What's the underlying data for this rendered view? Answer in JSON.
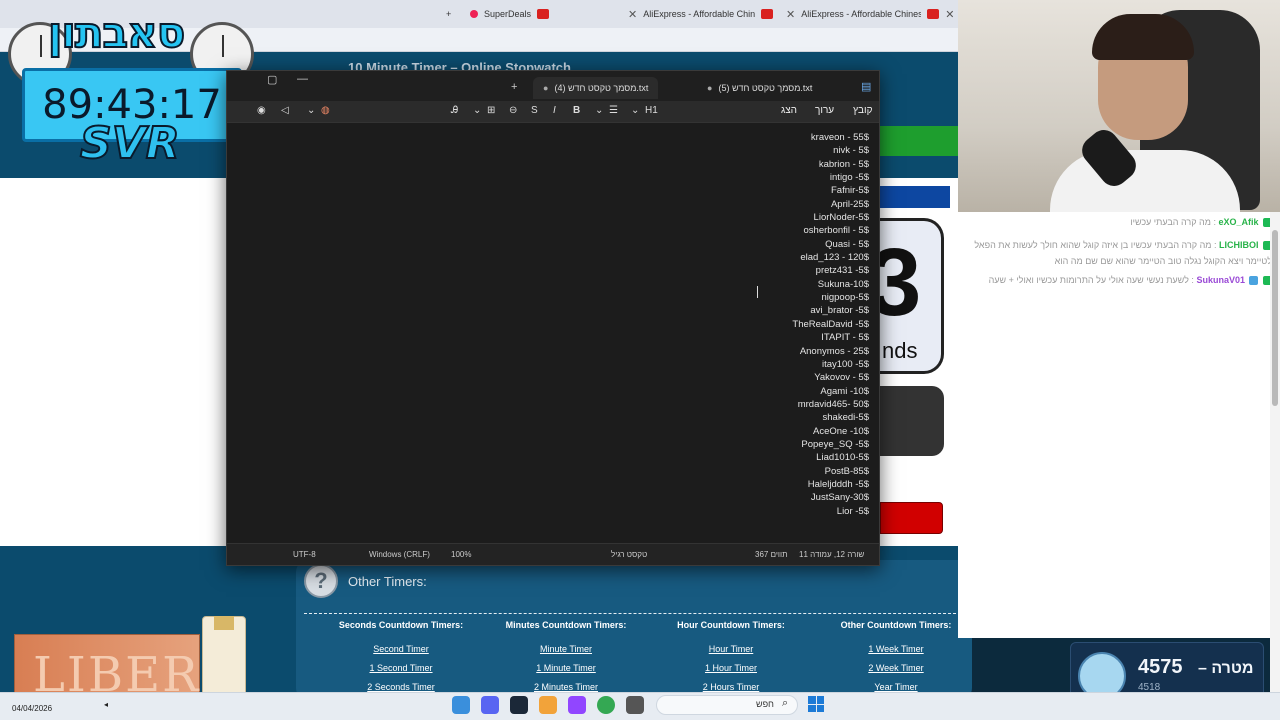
{
  "browser": {
    "tabs": [
      {
        "label": "SuperDeals"
      },
      {
        "label": "AliExpress - Affordable Chinese"
      },
      {
        "label": "AliExpress - Affordable Chinese"
      }
    ],
    "site_title": "10 Minute Timer – Online Stopwatch"
  },
  "overlay": {
    "logo_text": "סאבתון",
    "timer": "89:43:17",
    "tag": "SVR"
  },
  "site": {
    "digit": "3",
    "digit_unit": "nds",
    "other_timers_title": "Other Timers:",
    "columns": [
      {
        "heading": "Seconds Countdown Timers:",
        "links": [
          "Second Timer",
          "1 Second Timer",
          "2 Seconds Timer"
        ]
      },
      {
        "heading": "Minutes Countdown Timers:",
        "links": [
          "Minute Timer",
          "1 Minute Timer",
          "2 Minutes Timer"
        ]
      },
      {
        "heading": "Hour Countdown Timers:",
        "links": [
          "Hour Timer",
          "1 Hour Timer",
          "2 Hours Timer"
        ]
      },
      {
        "heading": "Other Countdown Timers:",
        "links": [
          "1 Week Timer",
          "2 Week Timer",
          "Year Timer"
        ]
      }
    ]
  },
  "notepad": {
    "tabs": [
      {
        "label": "מסמך טקסט חדש (5).txt"
      },
      {
        "label": "מסמך טקסט חדש (4).txt"
      }
    ],
    "menu": [
      "קובץ",
      "ערוך",
      "הצג"
    ],
    "toolbar": {
      "heading": "H1",
      "bold": "B",
      "italic": "I",
      "strike": "S"
    },
    "lines": [
      "kraveon - 55$",
      "nivk - 5$",
      "kabrion - 5$",
      "intigo -5$",
      "Fafnir-5$",
      "April-25$",
      "LiorNoder-5$",
      "osherbonfil - 5$",
      "Quasi - 5$",
      "elad_123 - 120$",
      "pretz431 -5$",
      "Sukuna-10$",
      "nigpoop-5$",
      "avi_brator -5$",
      "TheRealDavid -5$",
      "ITAPIT - 5$",
      "Anonymos - 25$",
      "itay100 -5$",
      "Yakovov - 5$",
      "Agami -10$",
      "mrdavid465- 50$",
      "shakedi-5$",
      "AceOne -10$",
      "Popeye_SQ -5$",
      "Liad1010-5$",
      "PostB-85$",
      "Haleljdddh -5$",
      "JustSany-30$",
      "Lior -5$"
    ],
    "status": {
      "position": "שורה 12, עמודה 11",
      "chars": "367 תווים",
      "format": "טקסט רגיל",
      "zoom": "100%",
      "line_ending": "Windows (CRLF)",
      "encoding": "UTF-8"
    }
  },
  "chat": {
    "messages": [
      {
        "user": "eXO_Afik",
        "text": "מה קרה הבעתי עכשיו"
      },
      {
        "user": "LICHIBOI",
        "text": "מה קרה הבעתי עכשיו בן איזה קוגל שהוא חולך לעשות את הפאל לטיימר ויצא הקוגל נגלה טוב הטיימר שהוא שם שם מה הוא"
      },
      {
        "user": "SukunaV01",
        "text": "לשעת נעשי שעה אולי על התרומות עכשיו ואולי + שעה"
      }
    ]
  },
  "goal": {
    "count": "4575",
    "label": "מטרה",
    "sub": "4518"
  },
  "ad": {
    "brand": "LIBERO"
  },
  "taskbar": {
    "date": "04/04/2026",
    "search": "חפש"
  },
  "colors": {
    "notepad_bg": "#1c1c1c",
    "site_bg": "#0b4b6d",
    "timer_box": "#39c7f3",
    "goal_bg": "#14304e"
  }
}
